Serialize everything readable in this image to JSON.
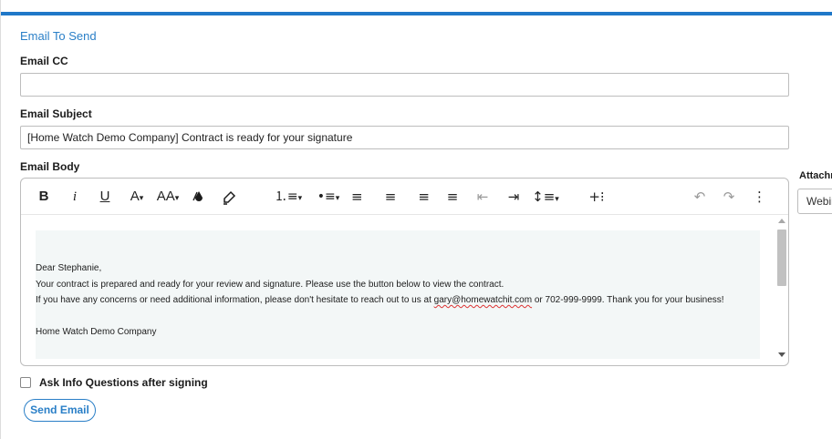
{
  "section_title": "Email To Send",
  "cc": {
    "label": "Email CC",
    "value": "",
    "placeholder": ""
  },
  "subject": {
    "label": "Email Subject",
    "value": "[Home Watch Demo Company] Contract is ready for your signature"
  },
  "body": {
    "label": "Email Body",
    "greeting": "Dear Stephanie,",
    "line1": "Your contract is prepared and ready for your review and signature.  Please use the button below to view the contract.",
    "line2_before": "If you have any concerns or need additional information, please don't hesitate to reach out to us at ",
    "email": "gary@homewatchit.com",
    "line2_after": " or 702-999-9999. Thank you for your business!",
    "signature": "Home Watch Demo Company"
  },
  "toolbar": {
    "bold": "B",
    "italic": "i",
    "underline": "U",
    "font_color": "A",
    "font_size": "AA",
    "dropdown_caret": "▾",
    "numbered_list": "⒈≡",
    "bullet_list": "•≡",
    "align_left": "≡",
    "align_center": "≡",
    "align_right": "≡",
    "justify": "≡",
    "outdent": "⇤",
    "indent": "⇥",
    "line_height": "↕≡",
    "insert": "+⁝",
    "undo": "↶",
    "redo": "↷",
    "more": "⋮"
  },
  "icons": {
    "fill_color": "droplet-icon",
    "highlighter": "highlighter-icon"
  },
  "ask_info": {
    "label": "Ask Info Questions after signing",
    "checked": false
  },
  "send_button": "Send Email",
  "attachment": {
    "label": "Attachm",
    "value": "Webin"
  },
  "colors": {
    "accent": "#1f78c8",
    "link": "#2a7fc7",
    "border": "#bdbdbd",
    "editor_bg": "#f3f7f7"
  }
}
